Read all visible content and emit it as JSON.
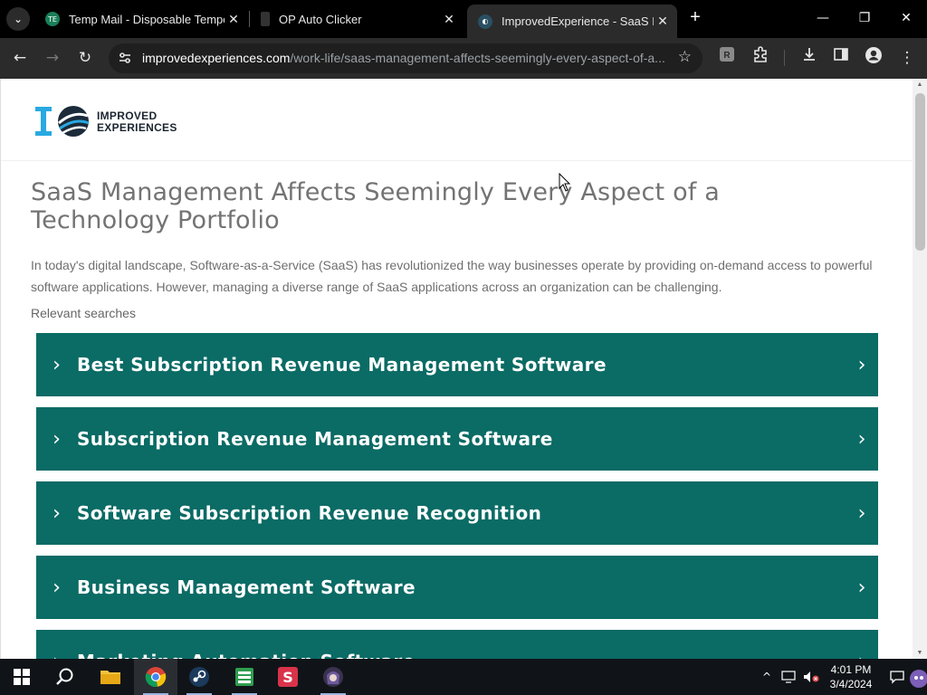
{
  "browser": {
    "tabs": [
      {
        "title": "Temp Mail - Disposable Temporary Email",
        "active": false
      },
      {
        "title": "OP Auto Clicker",
        "active": false
      },
      {
        "title": "ImprovedExperience - SaaS Management",
        "active": true
      }
    ],
    "tab_close_glyph": "✕",
    "new_tab_glyph": "+",
    "url_domain": "improvedexperiences.com",
    "url_path": "/work-life/saas-management-affects-seemingly-every-aspect-of-a...",
    "controls": {
      "minimize": "—",
      "restore": "❐",
      "close": "✕"
    }
  },
  "page": {
    "logo": {
      "line1": "IMPROVED",
      "line2": "EXPERIENCES"
    },
    "headline": "SaaS Management Affects Seemingly Every Aspect of a Technology Portfolio",
    "intro": "In today's digital landscape, Software-as-a-Service (SaaS) has revolutionized the way businesses operate by providing on-demand access to powerful software applications. However, managing a diverse range of SaaS applications across an organization can be challenging.",
    "relevant_label": "Relevant searches",
    "searches": [
      "Best Subscription Revenue Management Software",
      "Subscription Revenue Management Software",
      "Software Subscription Revenue Recognition",
      "Business Management Software",
      "Marketing Automation Software"
    ],
    "accent_color": "#0b6b65"
  },
  "taskbar": {
    "time": "4:01 PM",
    "date": "3/4/2024",
    "apps": [
      "start-icon",
      "search-icon",
      "file-explorer-icon",
      "chrome-icon",
      "steam-icon",
      "spreadsheet-icon",
      "app-s-icon",
      "anime-app-icon"
    ]
  }
}
